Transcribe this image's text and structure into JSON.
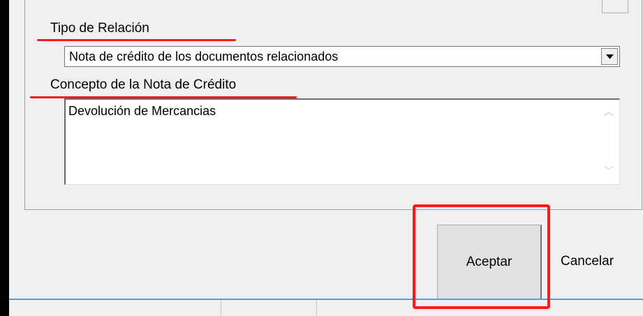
{
  "form": {
    "relation_type_label": "Tipo de Relación",
    "relation_type_value": "Nota de crédito de los documentos relacionados",
    "concept_label": "Concepto de la Nota de Crédito",
    "concept_value": "Devolución de Mercancias"
  },
  "buttons": {
    "accept_label": "Aceptar",
    "cancel_label": "Cancelar"
  },
  "colors": {
    "annotation": "#ff1a1a",
    "window_bg": "#f0f0f0",
    "status_accent": "#5b9bd5"
  },
  "icons": {
    "dropdown": "chevron-down-icon",
    "scroll_up": "scroll-up-icon",
    "scroll_down": "scroll-down-icon"
  }
}
